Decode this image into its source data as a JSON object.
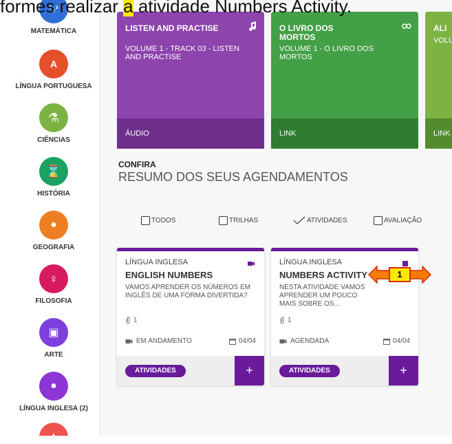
{
  "banner": {
    "prefix": "formes realizar ",
    "highlight": "a",
    "suffix": " atividade Numbers Activity."
  },
  "sidebar": {
    "items": [
      {
        "label": "MATEMÁTICA",
        "color": "#2f6fd6",
        "glyph": "¹₂³",
        "icon": "numbers-icon"
      },
      {
        "label": "LÍNGUA PORTUGUESA",
        "color": "#e5502b",
        "glyph": "A",
        "icon": "letters-icon"
      },
      {
        "label": "CIÊNCIAS",
        "color": "#7cb342",
        "glyph": "⚗",
        "icon": "flask-icon"
      },
      {
        "label": "HISTÓRIA",
        "color": "#1aa360",
        "glyph": "⌛",
        "icon": "hourglass-icon"
      },
      {
        "label": "GEOGRAFIA",
        "color": "#ef7d22",
        "glyph": "●",
        "icon": "globe-icon"
      },
      {
        "label": "FILOSOFIA",
        "color": "#d81b60",
        "glyph": "♀",
        "icon": "lightbulb-icon"
      },
      {
        "label": "ARTE",
        "color": "#7e3fe0",
        "glyph": "▣",
        "icon": "image-icon"
      },
      {
        "label": "LÍNGUA INGLESA (2)",
        "color": "#8e35d6",
        "glyph": "●",
        "icon": "chat-icon"
      },
      {
        "label": "",
        "color": "#ef5350",
        "glyph": "✦",
        "icon": "sport-icon"
      }
    ]
  },
  "content_cards": [
    {
      "title": "LISTEN AND PRACTISE",
      "subtitle": "VOLUME 1 - TRACK 03 - LISTEN AND PRACTISE",
      "footer": "ÁUDIO",
      "color": "#8e44ad",
      "footer_color": "#6e2f8c",
      "icon": "music-note-icon"
    },
    {
      "title": "O LIVRO DOS MORTOS",
      "subtitle": "VOLUME 1 - O LIVRO DOS MORTOS",
      "footer": "LINK",
      "color": "#43a047",
      "footer_color": "#2e7d32",
      "icon": "link-icon"
    },
    {
      "title": "ALI",
      "subtitle": "VOLU",
      "footer": "LINK",
      "color": "#7cb342",
      "footer_color": "#558b2f",
      "icon": ""
    }
  ],
  "section": {
    "kicker": "CONFIRA",
    "title": "RESUMO DOS SEUS AGENDAMENTOS"
  },
  "filters": [
    {
      "label": "TODOS",
      "checked": false
    },
    {
      "label": "TRILHAS",
      "checked": false
    },
    {
      "label": "ATIVIDADES",
      "checked": true
    },
    {
      "label": "AVALIAÇÃO",
      "checked": false
    }
  ],
  "activities": [
    {
      "subject": "LÍNGUA INGLESA",
      "title": "ENGLISH NUMBERS",
      "description": "VAMOS APRENDER OS NÚMEROS EM INGLÊS DE UMA FORMA DIVERTIDA?",
      "attachments": "1",
      "status": "EM ANDAMENTO",
      "date": "04/04",
      "button": "ATIVIDADES",
      "plus": "+"
    },
    {
      "subject": "LÍNGUA INGLESA",
      "title": "NUMBERS ACTIVITY",
      "description": "NESTA ATIVIDADE VAMOS APRENDER UM POUCO MAIS SOBRE OS...",
      "attachments": "1",
      "status": "AGENDADA",
      "date": "04/04",
      "button": "ATIVIDADES",
      "plus": "+"
    }
  ],
  "marker": {
    "number": "1"
  },
  "colors": {
    "accent": "#6a1b9a",
    "highlight": "#ffe800",
    "marker_arrow": "#f57c00",
    "marker_border": "#d62d00"
  }
}
